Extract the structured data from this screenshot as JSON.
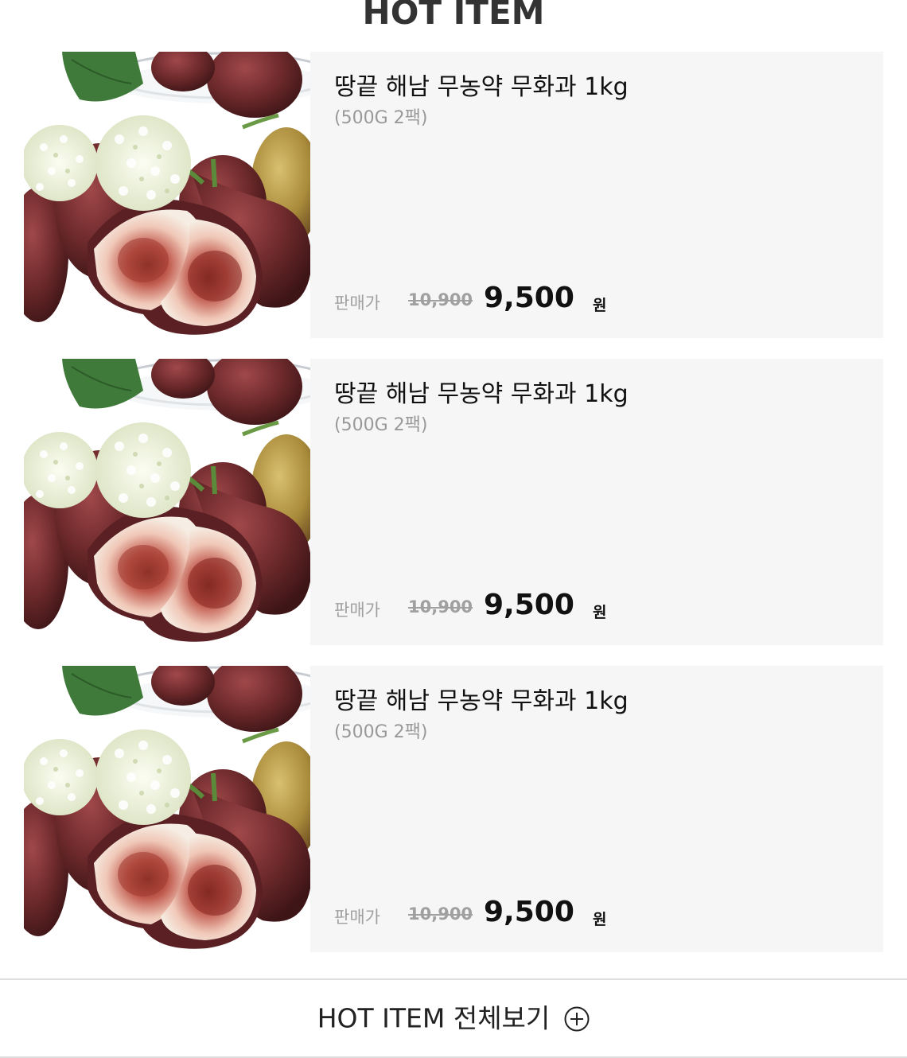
{
  "section": {
    "title": "HOT ITEM"
  },
  "products": [
    {
      "name": "땅끝 해남 무농약 무화과 1kg",
      "option": "(500G 2팩)",
      "price_label": "판매가",
      "original_price": "10,900",
      "sale_price": "9,500",
      "currency": "원",
      "image_icon": "fig-product-photo"
    },
    {
      "name": "땅끝 해남 무농약 무화과 1kg",
      "option": "(500G 2팩)",
      "price_label": "판매가",
      "original_price": "10,900",
      "sale_price": "9,500",
      "currency": "원",
      "image_icon": "fig-product-photo"
    },
    {
      "name": "땅끝 해남 무농약 무화과 1kg",
      "option": "(500G 2팩)",
      "price_label": "판매가",
      "original_price": "10,900",
      "sale_price": "9,500",
      "currency": "원",
      "image_icon": "fig-product-photo"
    }
  ],
  "footer": {
    "view_all_label": "HOT ITEM 전체보기",
    "view_all_icon": "plus-circle-icon"
  },
  "colors": {
    "card_background": "#f6f6f6",
    "muted_text": "#999999",
    "fig_purple": "#6e2a2c",
    "fig_flesh": "#c0605a",
    "leaf_green": "#3f7a3a",
    "flower_white": "#eef2e0"
  }
}
